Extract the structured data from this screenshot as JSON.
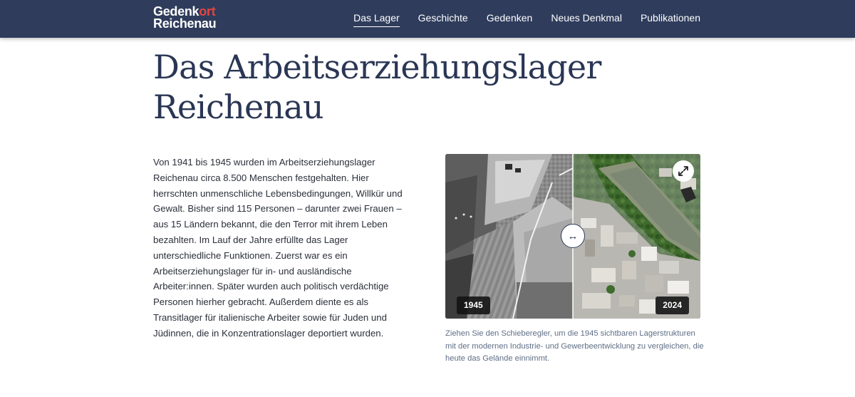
{
  "header": {
    "logo_line1_main": "Gedenk",
    "logo_line1_accent": "ort",
    "logo_line2": "Reichenau",
    "accent_color": "#e2463f",
    "background_color": "#2f3c5c",
    "nav": [
      {
        "label": "Das Lager",
        "active": true
      },
      {
        "label": "Geschichte",
        "active": false
      },
      {
        "label": "Gedenken",
        "active": false
      },
      {
        "label": "Neues Denkmal",
        "active": false
      },
      {
        "label": "Publikationen",
        "active": false
      }
    ]
  },
  "main": {
    "title_line1": "Das Arbeitserziehungslager",
    "title_line2": "Reichenau",
    "intro": "Von 1941 bis 1945 wurden im Arbeitserziehungslager Reichenau circa 8.500 Menschen festgehalten. Hier herrschten unmenschliche Lebensbedingungen, Willkür und Gewalt. Bisher sind 115 Personen – darunter zwei Frauen – aus 15 Ländern bekannt, die den Terror mit ihrem Leben bezahlten. Im Lauf der Jahre erfüllte das Lager unterschiedliche Funktionen. Zuerst war es ein Arbeitserziehungslager für in- und ausländische Arbeiter:innen. Später wurden auch politisch verdächtige Personen hierher gebracht. Außerdem diente es als Transitlager für italienische Arbeiter sowie für Juden und Jüdinnen, die in Konzentrationslager deportiert wurden."
  },
  "image_compare": {
    "left_year": "1945",
    "right_year": "2024",
    "slider_glyph": "↔",
    "expand_icon": "expand-icon",
    "caption": "Ziehen Sie den Schieberegler, um die 1945 sichtbaren Lagerstrukturen mit der modernen Industrie- und Gewerbeentwicklung zu vergleichen, die heute das Gelände einnimmt."
  }
}
